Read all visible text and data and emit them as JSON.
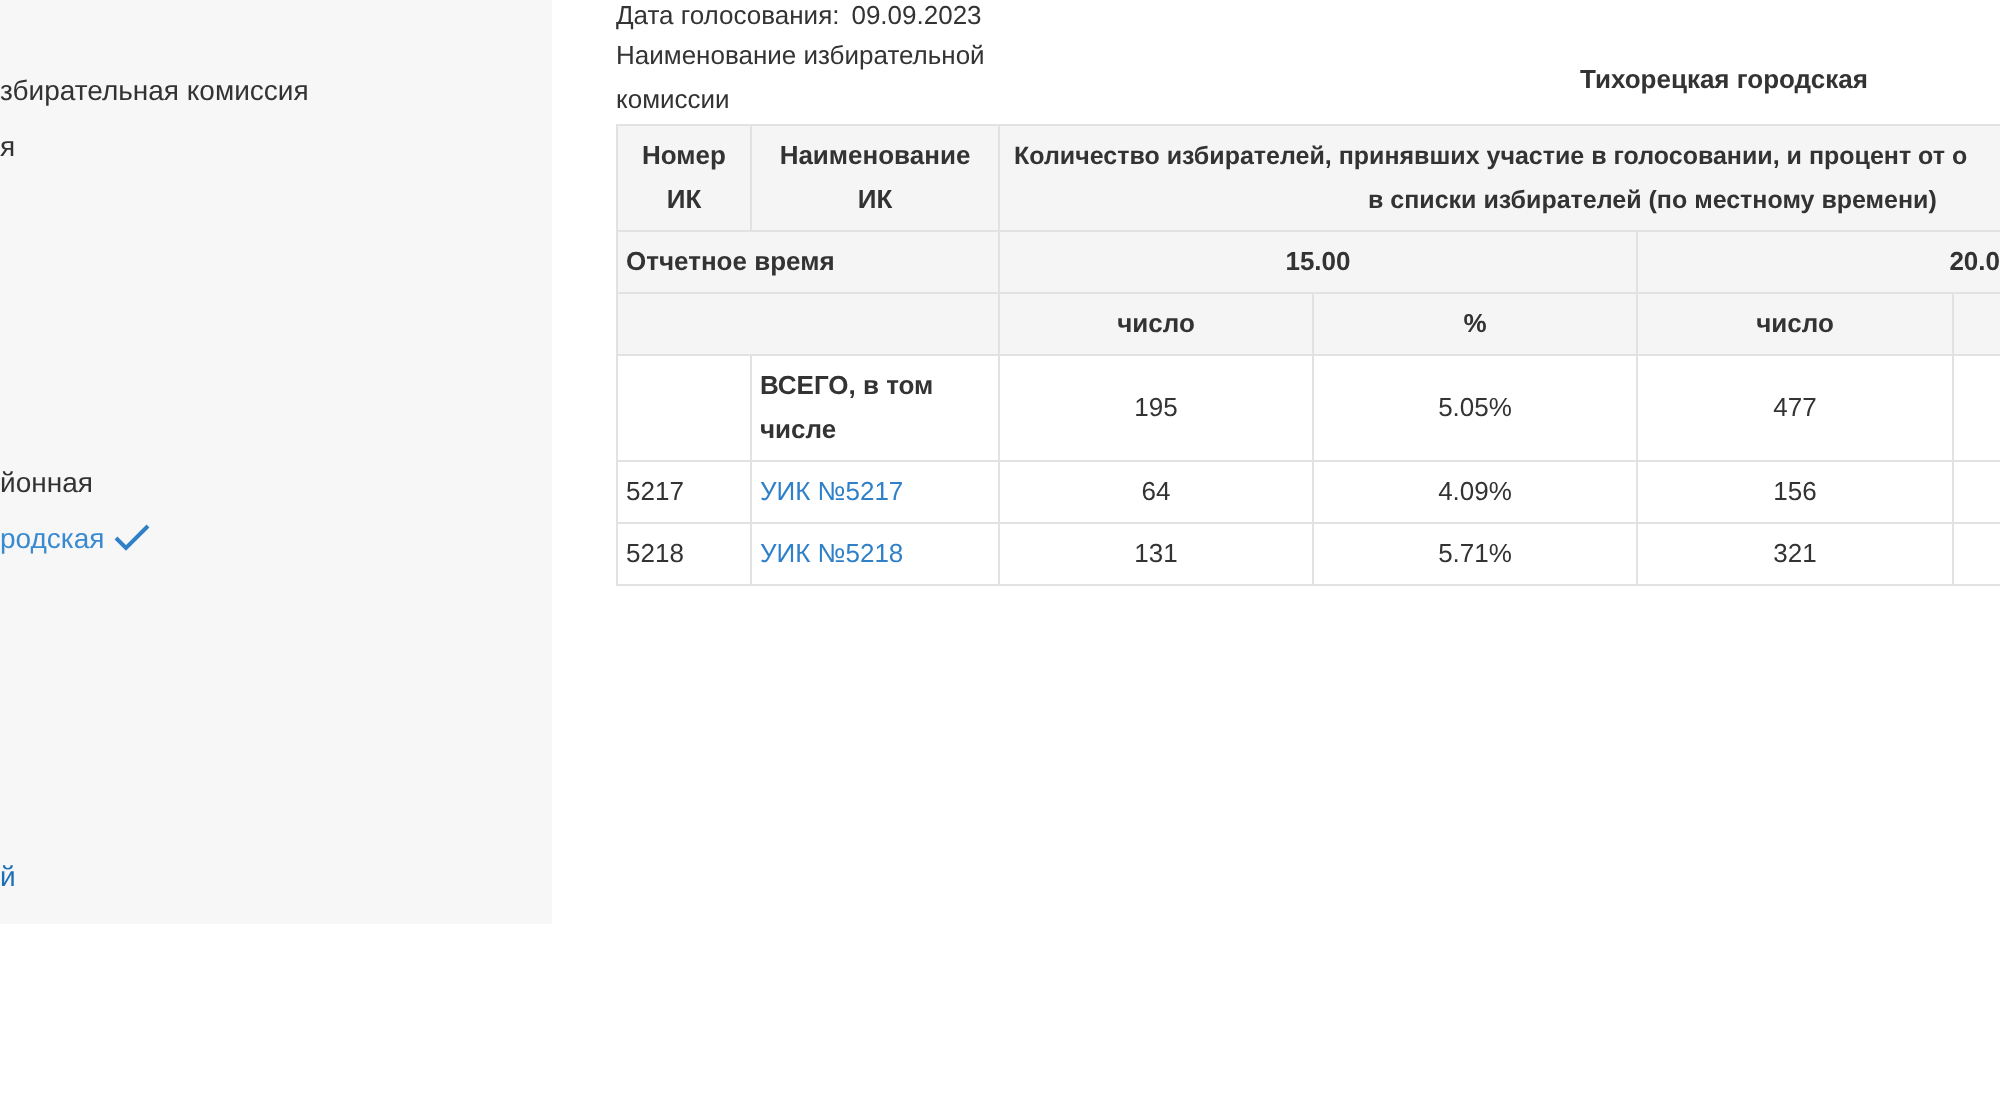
{
  "sidebar": {
    "items": [
      {
        "label": "збирательная комиссия",
        "selected": false
      },
      {
        "label": "я",
        "selected": false
      },
      {
        "label": "йонная",
        "selected": false
      },
      {
        "label": "родская",
        "selected": true
      },
      {
        "label": "й",
        "link": true,
        "selected": false
      }
    ]
  },
  "voting_date": {
    "label": "Дата голосования:",
    "value": "09.09.2023"
  },
  "commission": {
    "label": "Наименование избирательной комиссии",
    "value": "Тихорецкая городская"
  },
  "table": {
    "col_number": "Номер ИК",
    "col_name": "Наименование ИК",
    "heading_lines": [
      "Количество избирателей, принявших участие в голосовании, и процент от о",
      "в списки избирателей (по местному времени)"
    ],
    "time_label": "Отчетное время",
    "times": [
      "15.00",
      "20.0"
    ],
    "subheads": [
      "число",
      "%",
      "число"
    ],
    "rows": [
      {
        "number": "",
        "name": "ВСЕГО, в том числе",
        "kind": "total",
        "cells": [
          "195",
          "5.05%",
          "477"
        ]
      },
      {
        "number": "5217",
        "name": "УИК №5217",
        "kind": "link",
        "cells": [
          "64",
          "4.09%",
          "156"
        ]
      },
      {
        "number": "5218",
        "name": "УИК №5218",
        "kind": "link",
        "cells": [
          "131",
          "5.71%",
          "321"
        ]
      }
    ]
  }
}
